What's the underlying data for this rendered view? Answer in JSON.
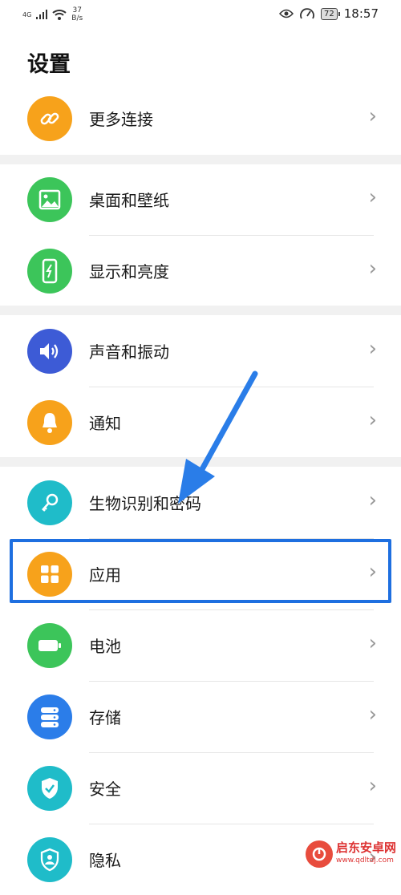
{
  "statusbar": {
    "network": "4G",
    "speed_value": "37",
    "speed_unit": "B/s",
    "battery": "72",
    "time": "18:57"
  },
  "page": {
    "title": "设置"
  },
  "colors": {
    "orange": "#f7a21b",
    "green": "#3cc55a",
    "indigo": "#3d5bd6",
    "teal": "#1fbcc9",
    "blue": "#2b7de9",
    "highlight": "#1e6fe0"
  },
  "items": [
    {
      "label": "更多连接",
      "icon": "link-icon",
      "color": "#f7a21b"
    },
    {
      "label": "桌面和壁纸",
      "icon": "image-icon",
      "color": "#3cc55a"
    },
    {
      "label": "显示和亮度",
      "icon": "phone-brightness-icon",
      "color": "#3cc55a"
    },
    {
      "label": "声音和振动",
      "icon": "speaker-icon",
      "color": "#3d5bd6"
    },
    {
      "label": "通知",
      "icon": "bell-icon",
      "color": "#f7a21b"
    },
    {
      "label": "生物识别和密码",
      "icon": "key-icon",
      "color": "#1fbcc9"
    },
    {
      "label": "应用",
      "icon": "apps-grid-icon",
      "color": "#f7a21b"
    },
    {
      "label": "电池",
      "icon": "battery-icon",
      "color": "#3cc55a"
    },
    {
      "label": "存储",
      "icon": "storage-icon",
      "color": "#2b7de9"
    },
    {
      "label": "安全",
      "icon": "shield-check-icon",
      "color": "#1fbcc9"
    },
    {
      "label": "隐私",
      "icon": "privacy-icon",
      "color": "#1fbcc9"
    }
  ],
  "watermark": {
    "name": "启东安卓网",
    "url": "www.qdltdj.com"
  }
}
